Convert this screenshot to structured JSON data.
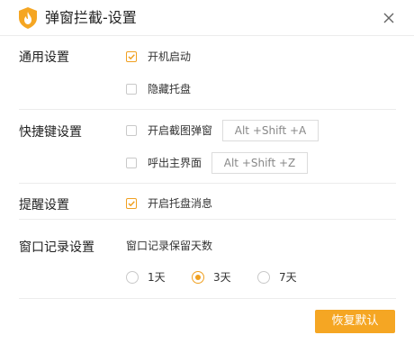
{
  "window": {
    "title": "弹窗拦截-设置",
    "logo_icon": "flame-shield-icon",
    "close_icon": "close-icon",
    "accent_color": "#f5a623"
  },
  "general": {
    "label": "通用设置",
    "auto_start": {
      "label": "开机启动",
      "checked": true
    },
    "hide_tray": {
      "label": "隐藏托盘",
      "checked": false
    }
  },
  "hotkeys": {
    "label": "快捷键设置",
    "screenshot_popup": {
      "label": "开启截图弹窗",
      "checked": false,
      "value": "Alt +Shift +A"
    },
    "main_ui": {
      "label": "呼出主界面",
      "checked": false,
      "value": "Alt +Shift +Z"
    }
  },
  "reminder": {
    "label": "提醒设置",
    "tray_message": {
      "label": "开启托盘消息",
      "checked": true
    }
  },
  "window_log": {
    "label": "窗口记录设置",
    "retention_label": "窗口记录保留天数",
    "options": [
      {
        "label": "1天",
        "selected": false
      },
      {
        "label": "3天",
        "selected": true
      },
      {
        "label": "7天",
        "selected": false
      }
    ]
  },
  "footer": {
    "restore_default_label": "恢复默认"
  }
}
